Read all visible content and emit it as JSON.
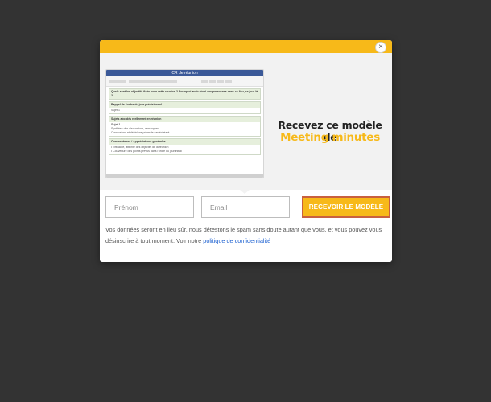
{
  "modal": {
    "close_glyph": "×",
    "headline": "Recevez ce modèle de",
    "headline_accent": "Meeting minutes",
    "accent_color": "#f7b919"
  },
  "preview": {
    "window_title": "CR de réunion",
    "sections": [
      {
        "header": "Quels sont les objectifs fixés pour cette réunion ? Pourquoi avoir réuni ces personnes dans ce lieu, ce jour-là ?",
        "body": ""
      },
      {
        "header": "Rappel de l'ordre du jour prévisionnel",
        "body": "Sujet 1"
      },
      {
        "header": "Sujets abordés réellement en réunion",
        "body_lines": [
          "Sujet 1",
          "Synthèse des discussions, remarques",
          "Conclusions et décisions prises le cas échéant"
        ]
      },
      {
        "header": "Commentaires / Appréciations générales",
        "body_lines": [
          "Efficacité, atteinte des objectifs de la réunion",
          "Couverture des points prévus dans l'ordre du jour initial"
        ]
      }
    ]
  },
  "form": {
    "first_name_placeholder": "Prénom",
    "email_placeholder": "Email",
    "submit_label": "RECEVOIR LE MODÈLE"
  },
  "disclaimer": {
    "text": "Vos données seront en lieu sûr, nous détestons le spam sans doute autant que vous, et vous pouvez vous désinscrire à tout moment. Voir notre ",
    "link": "politique de confidentialité"
  }
}
